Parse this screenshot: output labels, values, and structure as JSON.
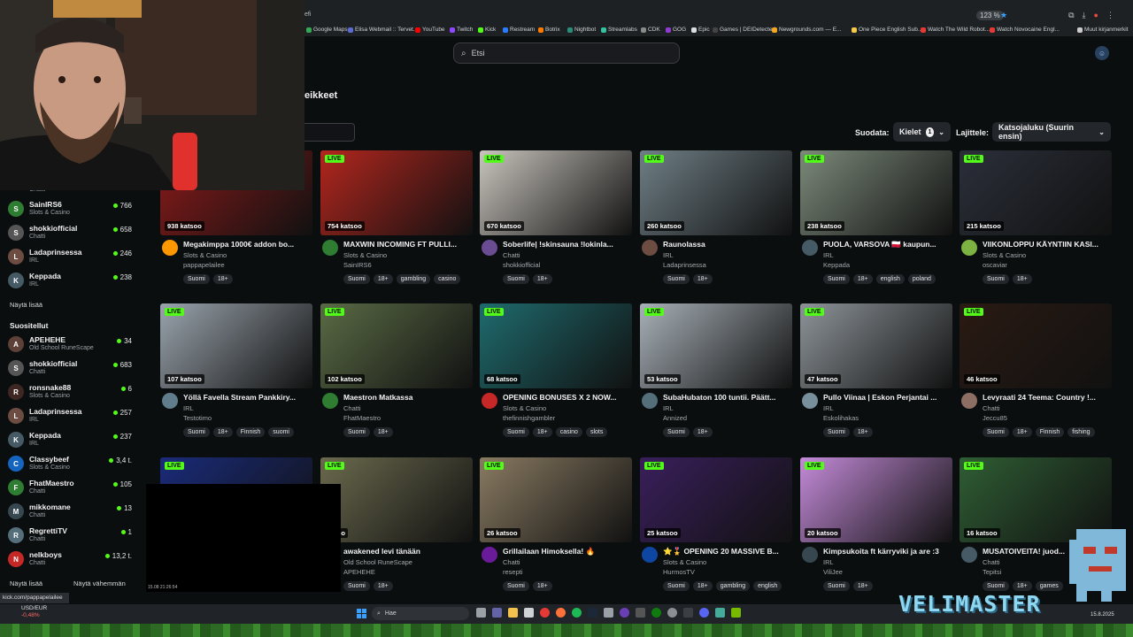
{
  "browser": {
    "zoom": "123 %",
    "url_fragment": "efi",
    "bookmarks": [
      {
        "label": "Google Maps",
        "color": "#34a853"
      },
      {
        "label": "Elisa Webmail :: Tervet...",
        "color": "#5b6bd5"
      },
      {
        "label": "YouTube",
        "color": "#ff0000"
      },
      {
        "label": "Twitch",
        "color": "#9146ff"
      },
      {
        "label": "Kick",
        "color": "#53fc18"
      },
      {
        "label": "Restream",
        "color": "#2b7bff"
      },
      {
        "label": "Botrix",
        "color": "#ff7a00"
      },
      {
        "label": "Nightbot",
        "color": "#2a8c7a"
      },
      {
        "label": "Streamlabs",
        "color": "#31c3a2"
      },
      {
        "label": "CDK",
        "color": "#8a8a8a"
      },
      {
        "label": "GOG",
        "color": "#8f3bd1"
      },
      {
        "label": "Epic",
        "color": "#dddddd"
      },
      {
        "label": "Games | DEIDetected",
        "color": "#444444"
      },
      {
        "label": "Newgrounds.com — E...",
        "color": "#f5a623"
      },
      {
        "label": "One Piece English Sub...",
        "color": "#f7c948"
      },
      {
        "label": "Watch The Wild Robot...",
        "color": "#e53935"
      },
      {
        "label": "Watch Novocaine Engl...",
        "color": "#e53935"
      },
      {
        "label": "Muut kirjanmerkit",
        "color": "#cccccc"
      }
    ]
  },
  "search": {
    "placeholder": "Etsi"
  },
  "page": {
    "title_fragment": "eikkeet"
  },
  "filters": {
    "filter_label": "Suodata:",
    "languages_label": "Kielet",
    "languages_count": "1",
    "sort_label": "Lajittele:",
    "sort_value": "Katsojaluku (Suurin ensin)"
  },
  "sidebar": {
    "following_fragment": "Chatti",
    "following": [
      {
        "name": "SainIRS6",
        "category": "Slots & Casino",
        "count": "766",
        "color": "#2e7d32",
        "initial": "S"
      },
      {
        "name": "shokkiofficial",
        "category": "Chatti",
        "count": "658",
        "color": "#555555",
        "initial": "S"
      },
      {
        "name": "Ladaprinsessa",
        "category": "IRL",
        "count": "246",
        "color": "#6d4c41",
        "initial": "L"
      },
      {
        "name": "Keppada",
        "category": "IRL",
        "count": "238",
        "color": "#455a64",
        "initial": "K"
      }
    ],
    "show_more_1": "Näytä lisää",
    "recommended_title": "Suositellut",
    "recommended": [
      {
        "name": "APEHEHE",
        "category": "Old School RuneScape",
        "count": "34",
        "color": "#5d4037",
        "initial": "A"
      },
      {
        "name": "shokkiofficial",
        "category": "Chatti",
        "count": "683",
        "color": "#555555",
        "initial": "S"
      },
      {
        "name": "ronsnake88",
        "category": "Slots & Casino",
        "count": "6",
        "color": "#3e2723",
        "initial": "R"
      },
      {
        "name": "Ladaprinsessa",
        "category": "IRL",
        "count": "257",
        "color": "#6d4c41",
        "initial": "L"
      },
      {
        "name": "Keppada",
        "category": "IRL",
        "count": "237",
        "color": "#455a64",
        "initial": "K"
      },
      {
        "name": "Classybeef",
        "category": "Slots & Casino",
        "count": "3,4 t.",
        "color": "#1565c0",
        "initial": "C"
      },
      {
        "name": "FhatMaestro",
        "category": "Chatti",
        "count": "105",
        "color": "#2e7d32",
        "initial": "F"
      },
      {
        "name": "mikkomane",
        "category": "Chatti",
        "count": "13",
        "color": "#37474f",
        "initial": "M"
      },
      {
        "name": "RegrettiTV",
        "category": "Chatti",
        "count": "1",
        "color": "#546e7a",
        "initial": "R"
      },
      {
        "name": "nelkboys",
        "category": "Chatti",
        "count": "13,2 t.",
        "color": "#c62828",
        "initial": "N"
      }
    ],
    "show_more_2": "Näytä lisää",
    "show_less": "Näytä vähemmän"
  },
  "streams": [
    {
      "viewers": "938 katsoo",
      "title": "Megakimppa 1000€ addon bo...",
      "category": "Slots & Casino",
      "channel": "pappapelailee",
      "tags": [
        "Suomi",
        "18+"
      ],
      "thumb": "#8b1a1a",
      "avatar": "#ff9800"
    },
    {
      "viewers": "754 katsoo",
      "title": "MAXWIN INCOMING FT PULLI...",
      "category": "Slots & Casino",
      "channel": "SainIRS6",
      "tags": [
        "Suomi",
        "18+",
        "gambling",
        "casino"
      ],
      "thumb": "#b3261e",
      "avatar": "#2e7d32"
    },
    {
      "viewers": "670 katsoo",
      "title": "Soberlife| !skinsauna !lokinla...",
      "category": "Chatti",
      "channel": "shokkiofficial",
      "tags": [
        "Suomi",
        "18+"
      ],
      "thumb": "#c9c5be",
      "avatar": "#6a4c93"
    },
    {
      "viewers": "260 katsoo",
      "title": "Raunolassa",
      "category": "IRL",
      "channel": "Ladaprinsessa",
      "tags": [
        "Suomi",
        "18+"
      ],
      "thumb": "#6f7f86",
      "avatar": "#6d4c41"
    },
    {
      "viewers": "238 katsoo",
      "title": "PUOLA, VARSOVA 🇵🇱 kaupun...",
      "category": "IRL",
      "channel": "Keppada",
      "tags": [
        "Suomi",
        "18+",
        "english",
        "poland"
      ],
      "thumb": "#7c8a7a",
      "avatar": "#455a64"
    },
    {
      "viewers": "215 katsoo",
      "title": "VIIKONLOPPU KÄYNTIIN KASI...",
      "category": "Slots & Casino",
      "channel": "oscaviar",
      "tags": [
        "Suomi",
        "18+"
      ],
      "thumb": "#2b2f3a",
      "avatar": "#7cb342"
    },
    {
      "viewers": "107 katsoo",
      "title": "Yöllä Favella Stream Pankkiry...",
      "category": "IRL",
      "channel": "Testotimo",
      "tags": [
        "Suomi",
        "18+",
        "Finnish",
        "suomi"
      ],
      "thumb": "#9aa4ad",
      "avatar": "#607d8b"
    },
    {
      "viewers": "102 katsoo",
      "title": "Maestron Matkassa",
      "category": "Chatti",
      "channel": "FhatMaestro",
      "tags": [
        "Suomi",
        "18+"
      ],
      "thumb": "#5a6b45",
      "avatar": "#2e7d32"
    },
    {
      "viewers": "68 katsoo",
      "title": "OPENING BONUSES X 2 NOW...",
      "category": "Slots & Casino",
      "channel": "thefinnishgambler",
      "tags": [
        "Suomi",
        "18+",
        "casino",
        "slots"
      ],
      "thumb": "#1f6b6e",
      "avatar": "#c62828"
    },
    {
      "viewers": "53 katsoo",
      "title": "SubaHubaton 100 tuntii. Päätt...",
      "category": "IRL",
      "channel": "Annized",
      "tags": [
        "Suomi",
        "18+"
      ],
      "thumb": "#a8b1b8",
      "avatar": "#546e7a"
    },
    {
      "viewers": "47 katsoo",
      "title": "Pullo Viinaa | Eskon Perjantai ...",
      "category": "IRL",
      "channel": "Eskolihakas",
      "tags": [
        "Suomi",
        "18+"
      ],
      "thumb": "#8d9499",
      "avatar": "#78909c"
    },
    {
      "viewers": "46 katsoo",
      "title": "Levyraati 24 Teema: Country !...",
      "category": "Chatti",
      "channel": "Jeccu85",
      "tags": [
        "Suomi",
        "18+",
        "Finnish",
        "fishing"
      ],
      "thumb": "#2a1a12",
      "avatar": "#8d6e63"
    },
    {
      "viewers": "",
      "title": "",
      "category": "",
      "channel": "",
      "tags": [],
      "thumb": "#1a2b7a",
      "avatar": "#333333"
    },
    {
      "viewers": "atsoo",
      "title": "awakened levi tänään",
      "category": "Old School RuneScape",
      "channel": "APEHEHE",
      "tags": [
        "Suomi",
        "18+"
      ],
      "thumb": "#6b6a4e",
      "avatar": "#5d4037"
    },
    {
      "viewers": "26 katsoo",
      "title": "Grillailaan Himoksella! 🔥",
      "category": "Chatti",
      "channel": "resepti",
      "tags": [
        "Suomi",
        "18+"
      ],
      "thumb": "#8a7b62",
      "avatar": "#6a1b9a"
    },
    {
      "viewers": "25 katsoo",
      "title": "⭐🎖️ OPENING 20 MASSIVE B...",
      "category": "Slots & Casino",
      "channel": "HurmosTV",
      "tags": [
        "Suomi",
        "18+",
        "gambling",
        "english"
      ],
      "thumb": "#3a1f5c",
      "avatar": "#0d47a1"
    },
    {
      "viewers": "20 katsoo",
      "title": "Kimpsukoita ft kärryviki ja are :3",
      "category": "IRL",
      "channel": "ViliJee",
      "tags": [
        "Suomi",
        "18+"
      ],
      "thumb": "#c48bd9",
      "avatar": "#37474f"
    },
    {
      "viewers": "16 katsoo",
      "title": "MUSATOIVEITA! juod...",
      "category": "Chatti",
      "channel": "Tepitsi",
      "tags": [
        "Suomi",
        "18+",
        "games"
      ],
      "thumb": "#2f5e34",
      "avatar": "#455a64"
    }
  ],
  "overlay": {
    "brand": "VELIMASTER",
    "hover_url": "kick.com/pappapelailee",
    "blackbox_time": "15.08 21:26:54"
  },
  "taskbar": {
    "search_placeholder": "Hae",
    "ticker_pair": "USD/EUR",
    "ticker_change": "-0,48%",
    "date": "15.8.2025"
  }
}
